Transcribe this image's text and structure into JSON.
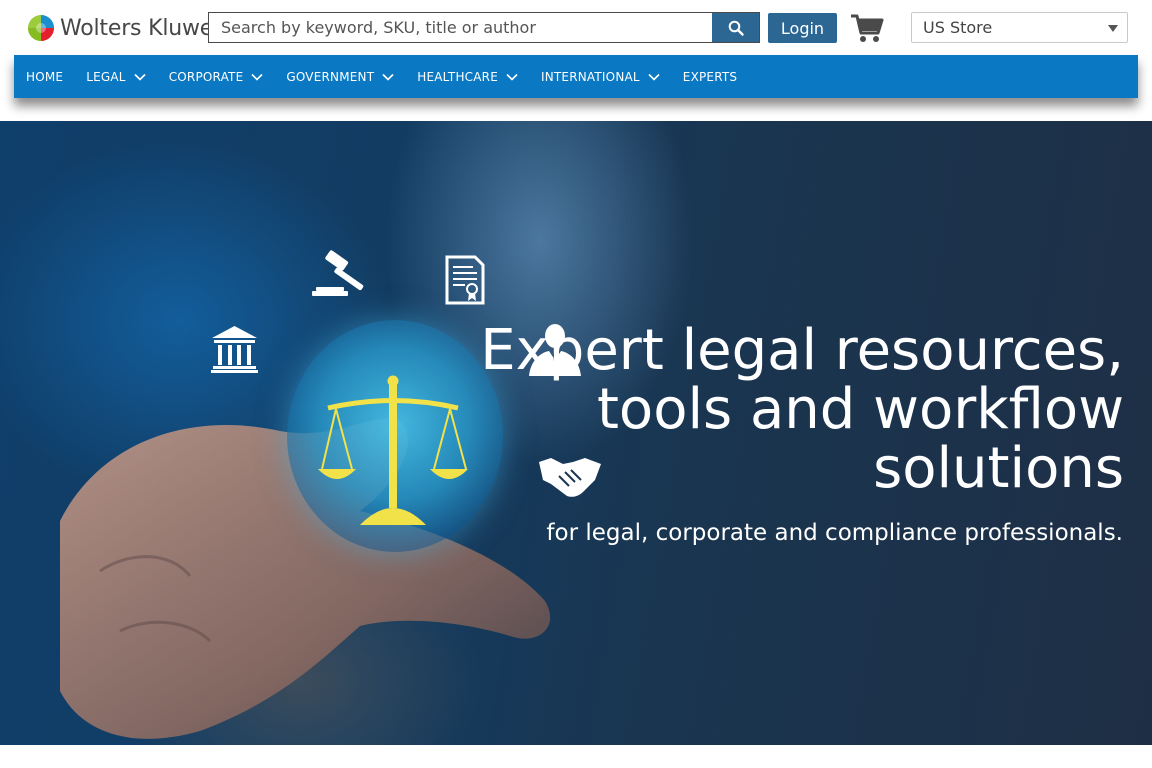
{
  "header": {
    "brand": "Wolters Kluwer",
    "search_placeholder": "Search by keyword, SKU, title or author",
    "search_icon": "search-icon",
    "login_label": "Login",
    "cart_icon": "shopping-cart-icon",
    "store_selected": "US Store"
  },
  "nav": {
    "items": [
      {
        "label": "HOME",
        "dropdown": false
      },
      {
        "label": "LEGAL",
        "dropdown": true
      },
      {
        "label": "CORPORATE",
        "dropdown": true
      },
      {
        "label": "GOVERNMENT",
        "dropdown": true
      },
      {
        "label": "HEALTHCARE",
        "dropdown": true
      },
      {
        "label": "INTERNATIONAL",
        "dropdown": true
      },
      {
        "label": "EXPERTS",
        "dropdown": false
      }
    ]
  },
  "hero": {
    "headline_lines": [
      "Expert legal resources,",
      "tools and workflow",
      "solutions"
    ],
    "subheadline": "for legal, corporate and compliance professionals.",
    "icons": [
      "gavel-icon",
      "certificate-document-icon",
      "courthouse-icon",
      "businessman-icon",
      "handshake-icon",
      "scales-of-justice-icon"
    ]
  },
  "colors": {
    "nav_blue": "#0b78c4",
    "button_blue": "#2c6693",
    "hero_dark": "#1a3550",
    "scales_yellow": "#f2e24a"
  }
}
